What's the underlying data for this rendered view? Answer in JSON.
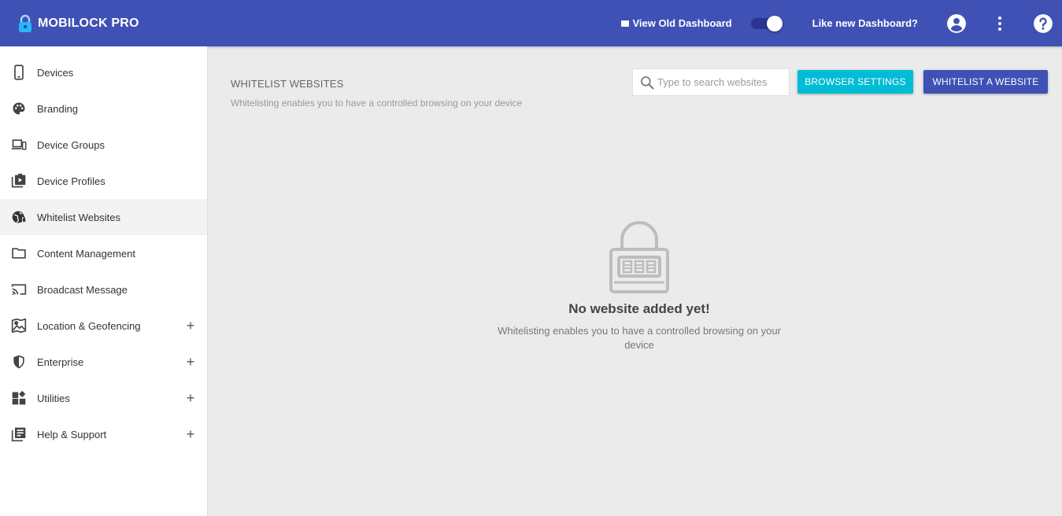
{
  "header": {
    "title": "MOBILOCK PRO",
    "old_dashboard_label": "View Old Dashboard",
    "like_new_label": "Like new Dashboard?",
    "toggle_on": true
  },
  "sidebar": {
    "items": [
      {
        "label": "Devices",
        "icon": "phone-icon",
        "expandable": false
      },
      {
        "label": "Branding",
        "icon": "palette-icon",
        "expandable": false
      },
      {
        "label": "Device Groups",
        "icon": "devices-icon",
        "expandable": false
      },
      {
        "label": "Device Profiles",
        "icon": "profiles-icon",
        "expandable": false
      },
      {
        "label": "Whitelist Websites",
        "icon": "globe-icon",
        "expandable": false,
        "active": true
      },
      {
        "label": "Content Management",
        "icon": "folder-icon",
        "expandable": false
      },
      {
        "label": "Broadcast Message",
        "icon": "cast-icon",
        "expandable": false
      },
      {
        "label": "Location & Geofencing",
        "icon": "map-icon",
        "expandable": true
      },
      {
        "label": "Enterprise",
        "icon": "shield-icon",
        "expandable": true
      },
      {
        "label": "Utilities",
        "icon": "widgets-icon",
        "expandable": true
      },
      {
        "label": "Help & Support",
        "icon": "library-icon",
        "expandable": true
      }
    ],
    "expand_symbol": "+"
  },
  "main": {
    "title": "WHITELIST WEBSITES",
    "subtitle": "Whitelisting enables you to have a controlled browsing on your device",
    "search": {
      "placeholder": "Type to search websites",
      "value": ""
    },
    "browser_settings_label": "BROWSER SETTINGS",
    "whitelist_label": "WHITELIST A WEBSITE",
    "empty": {
      "title": "No website added yet!",
      "text": "Whitelisting enables you to have a controlled browsing on your device"
    }
  },
  "colors": {
    "primary": "#3f51b5",
    "accent": "#00bcd4",
    "background": "#ebebeb"
  }
}
